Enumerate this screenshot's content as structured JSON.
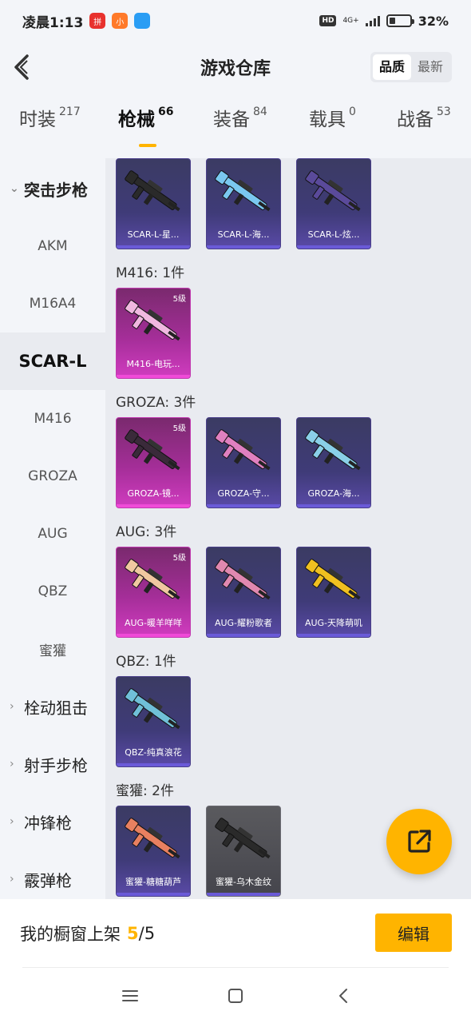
{
  "status": {
    "time": "凌晨1:13",
    "app1": "拼",
    "app2": "小",
    "hd": "HD",
    "network": "4G+",
    "battery_percent": "32%",
    "battery_level": 0.32
  },
  "header": {
    "title": "游戏仓库",
    "sort_options": [
      "品质",
      "最新"
    ],
    "sort_active": "品质"
  },
  "tabs": [
    {
      "label": "时装",
      "count": "217"
    },
    {
      "label": "枪械",
      "count": "66"
    },
    {
      "label": "装备",
      "count": "84"
    },
    {
      "label": "载具",
      "count": "0"
    },
    {
      "label": "战备",
      "count": "53"
    }
  ],
  "sidebar": {
    "groups": [
      {
        "label": "突击步枪",
        "open": true
      },
      {
        "label": "栓动狙击"
      },
      {
        "label": "射手步枪"
      },
      {
        "label": "冲锋枪"
      },
      {
        "label": "霰弹枪"
      }
    ],
    "items": [
      "AKM",
      "M16A4",
      "SCAR-L",
      "M416",
      "GROZA",
      "AUG",
      "QBZ",
      "蜜獾"
    ],
    "active": "SCAR-L"
  },
  "sections": [
    {
      "title": "",
      "cards": [
        {
          "name": "SCAR-L-星...",
          "style": "purple",
          "level": "",
          "color": "#2a2a2a"
        },
        {
          "name": "SCAR-L-海...",
          "style": "purple",
          "level": "",
          "color": "#7ac8f0"
        },
        {
          "name": "SCAR-L-炫...",
          "style": "purple",
          "level": "",
          "color": "#5a4a9a"
        }
      ]
    },
    {
      "title": "M416: 1件",
      "cards": [
        {
          "name": "M416-电玩...",
          "style": "pink",
          "level": "5级",
          "color": "#f0b8e0"
        }
      ]
    },
    {
      "title": "GROZA: 3件",
      "cards": [
        {
          "name": "GROZA-镜...",
          "style": "pink",
          "level": "5级",
          "color": "#3a2a3a"
        },
        {
          "name": "GROZA-守...",
          "style": "purple",
          "level": "",
          "color": "#e080c0"
        },
        {
          "name": "GROZA-海...",
          "style": "purple",
          "level": "",
          "color": "#8ad0e8"
        }
      ]
    },
    {
      "title": "AUG: 3件",
      "cards": [
        {
          "name": "AUG-暖羊咩咩",
          "style": "pink",
          "level": "5级",
          "color": "#f0c8a0"
        },
        {
          "name": "AUG-耀粉歌者",
          "style": "purple",
          "level": "",
          "color": "#e088b0"
        },
        {
          "name": "AUG-天降萌叽",
          "style": "purple",
          "level": "",
          "color": "#f0c020"
        }
      ]
    },
    {
      "title": "QBZ: 1件",
      "cards": [
        {
          "name": "QBZ-纯真浪花",
          "style": "purple",
          "level": "",
          "color": "#70c0d8"
        }
      ]
    },
    {
      "title": "蜜獾: 2件",
      "cards": [
        {
          "name": "蜜獾-糖糖葫芦",
          "style": "purple",
          "level": "",
          "color": "#e88060"
        },
        {
          "name": "蜜獾-乌木金纹",
          "style": "gray",
          "level": "",
          "color": "#2a2a2a"
        }
      ]
    }
  ],
  "footer": {
    "label": "我的橱窗上架",
    "count": "5",
    "total": "/5",
    "edit_label": "编辑"
  }
}
